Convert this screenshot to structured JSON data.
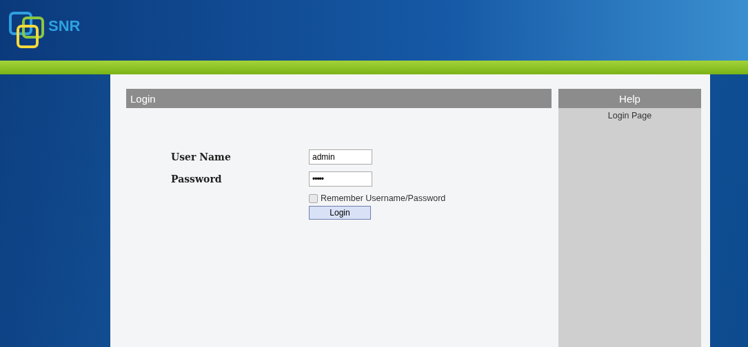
{
  "header": {
    "logo_text": "SNR"
  },
  "login": {
    "title": "Login",
    "fields": [
      {
        "label": "User Name",
        "value": "admin",
        "kind": "text"
      },
      {
        "label": "Password",
        "value": "•••••",
        "kind": "password"
      }
    ],
    "remember": {
      "label": "Remember Username/Password",
      "checked": false
    },
    "button": "Login"
  },
  "help": {
    "title": "Help",
    "text": "Login Page"
  }
}
